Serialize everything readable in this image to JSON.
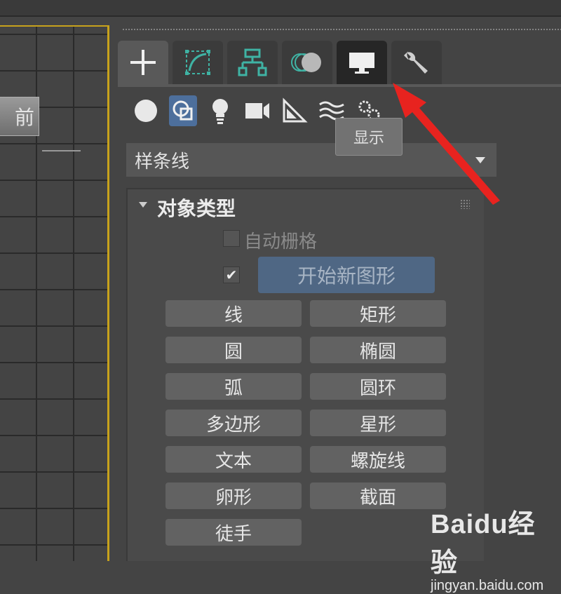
{
  "viewport": {
    "label": "前"
  },
  "tabs": [
    {
      "name": "create",
      "icon": "plus-icon"
    },
    {
      "name": "modify",
      "icon": "curve-modify-icon"
    },
    {
      "name": "hierarchy",
      "icon": "hierarchy-icon"
    },
    {
      "name": "motion",
      "icon": "motion-circles-icon"
    },
    {
      "name": "display",
      "icon": "monitor-icon"
    },
    {
      "name": "utilities",
      "icon": "wrench-icon"
    }
  ],
  "subcategories": [
    "sphere-icon",
    "shapes-icon",
    "light-bulb-icon",
    "camera-icon",
    "helper-triangle-icon",
    "space-warp-icon",
    "systems-gear-icon"
  ],
  "tooltip": {
    "text": "显示"
  },
  "dropdown": {
    "value": "样条线"
  },
  "rollout": {
    "title": "对象类型",
    "auto_grid": "自动栅格",
    "start_new_shape": "开始新图形",
    "start_new_checked": "✔",
    "buttons": [
      "线",
      "矩形",
      "圆",
      "椭圆",
      "弧",
      "圆环",
      "多边形",
      "星形",
      "文本",
      "螺旋线",
      "卵形",
      "截面",
      "徒手"
    ]
  },
  "watermark": {
    "main": "Baidu经验",
    "sub": "jingyan.baidu.com"
  },
  "colors": {
    "accent_blue": "#4d6f9c",
    "viewport_border": "#c7a21c",
    "annotation_arrow": "#e8231f"
  }
}
